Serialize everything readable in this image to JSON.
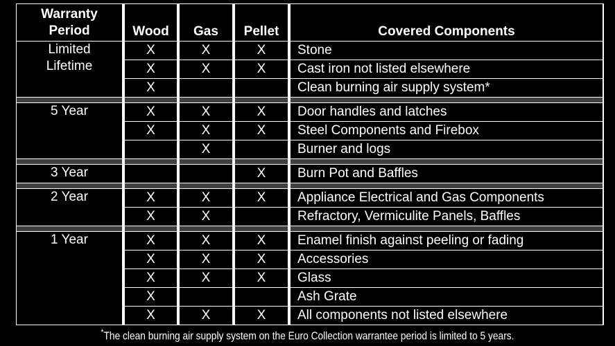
{
  "table": {
    "headers": {
      "period_line1": "Warranty",
      "period_line2": "Period",
      "wood": "Wood",
      "gas": "Gas",
      "pellet": "Pellet",
      "components": "Covered Components"
    },
    "groups": [
      {
        "period_line1": "Limited",
        "period_line2": "Lifetime",
        "rows": [
          {
            "wood": "X",
            "gas": "X",
            "pellet": "X",
            "component": "Stone"
          },
          {
            "wood": "X",
            "gas": "X",
            "pellet": "X",
            "component": "Cast iron not listed elsewhere"
          },
          {
            "wood": "X",
            "gas": "",
            "pellet": "",
            "component": "Clean burning air supply system*"
          }
        ]
      },
      {
        "period_line1": "5 Year",
        "period_line2": "",
        "rows": [
          {
            "wood": "X",
            "gas": "X",
            "pellet": "X",
            "component": "Door handles and latches"
          },
          {
            "wood": "X",
            "gas": "X",
            "pellet": "X",
            "component": "Steel Components and Firebox"
          },
          {
            "wood": "",
            "gas": "X",
            "pellet": "",
            "component": "Burner and logs"
          }
        ]
      },
      {
        "period_line1": "3 Year",
        "period_line2": "",
        "rows": [
          {
            "wood": "",
            "gas": "",
            "pellet": "X",
            "component": "Burn Pot and Baffles"
          }
        ]
      },
      {
        "period_line1": "2 Year",
        "period_line2": "",
        "rows": [
          {
            "wood": "X",
            "gas": "X",
            "pellet": "X",
            "component": "Appliance Electrical and Gas Components"
          },
          {
            "wood": "X",
            "gas": "X",
            "pellet": "",
            "component": "Refractory, Vermiculite Panels, Baffles"
          }
        ]
      },
      {
        "period_line1": "1 Year",
        "period_line2": "",
        "rows": [
          {
            "wood": "X",
            "gas": "X",
            "pellet": "X",
            "component": "Enamel finish against peeling or fading"
          },
          {
            "wood": "X",
            "gas": "X",
            "pellet": "X",
            "component": "Accessories"
          },
          {
            "wood": "X",
            "gas": "X",
            "pellet": "X",
            "component": "Glass"
          },
          {
            "wood": "X",
            "gas": "",
            "pellet": "",
            "component": "Ash Grate"
          },
          {
            "wood": "X",
            "gas": "X",
            "pellet": "X",
            "component": "All components not listed elsewhere"
          }
        ]
      }
    ]
  },
  "footnote": {
    "marker": "*",
    "text": "The clean burning air supply system on the Euro Collection warrantee period is limited to 5 years."
  },
  "colors": {
    "background": "#000000",
    "text": "#ffffff",
    "separator": "#404040",
    "grid": "#ffffff"
  }
}
